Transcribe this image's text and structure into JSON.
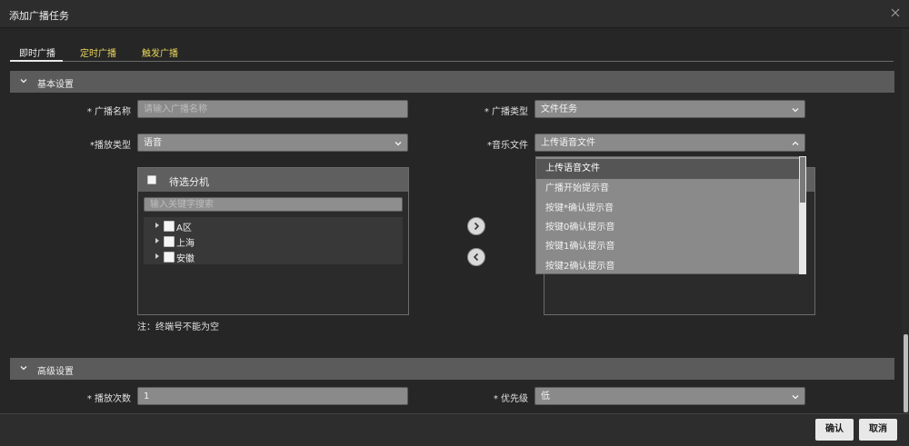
{
  "dialog": {
    "title": "添加广播任务"
  },
  "tabs": [
    {
      "label": "即时广播",
      "active": true
    },
    {
      "label": "定时广播",
      "active": false
    },
    {
      "label": "触发广播",
      "active": false
    }
  ],
  "basic": {
    "title": "基本设置",
    "name_label": "* 广播名称",
    "name_placeholder": "请输入广播名称",
    "type_label": "* 广播类型",
    "type_value": "文件任务",
    "play_type_label": "*播放类型",
    "play_type_value": "语音",
    "music_label": "*音乐文件",
    "music_value": "上传语音文件",
    "panel_title": "待选分机",
    "search_placeholder": "输入关键字搜索",
    "tree": [
      "A区",
      "上海",
      "安徽"
    ],
    "note": "注：终端号不能为空",
    "dropdown_items": [
      "上传语音文件",
      "广播开始提示音",
      "按键*确认提示音",
      "按键0确认提示音",
      "按键1确认提示音",
      "按键2确认提示音"
    ]
  },
  "advanced": {
    "title": "高级设置",
    "count_label": "* 播放次数",
    "count_value": "1",
    "priority_label": "* 优先级",
    "priority_value": "低"
  },
  "footer": {
    "confirm": "确认",
    "cancel": "取消"
  },
  "colors": {
    "background": "#262626",
    "section_header": "#5b5b5b",
    "input": "#8a8a8a",
    "tab_inactive": "#e8d45a"
  }
}
